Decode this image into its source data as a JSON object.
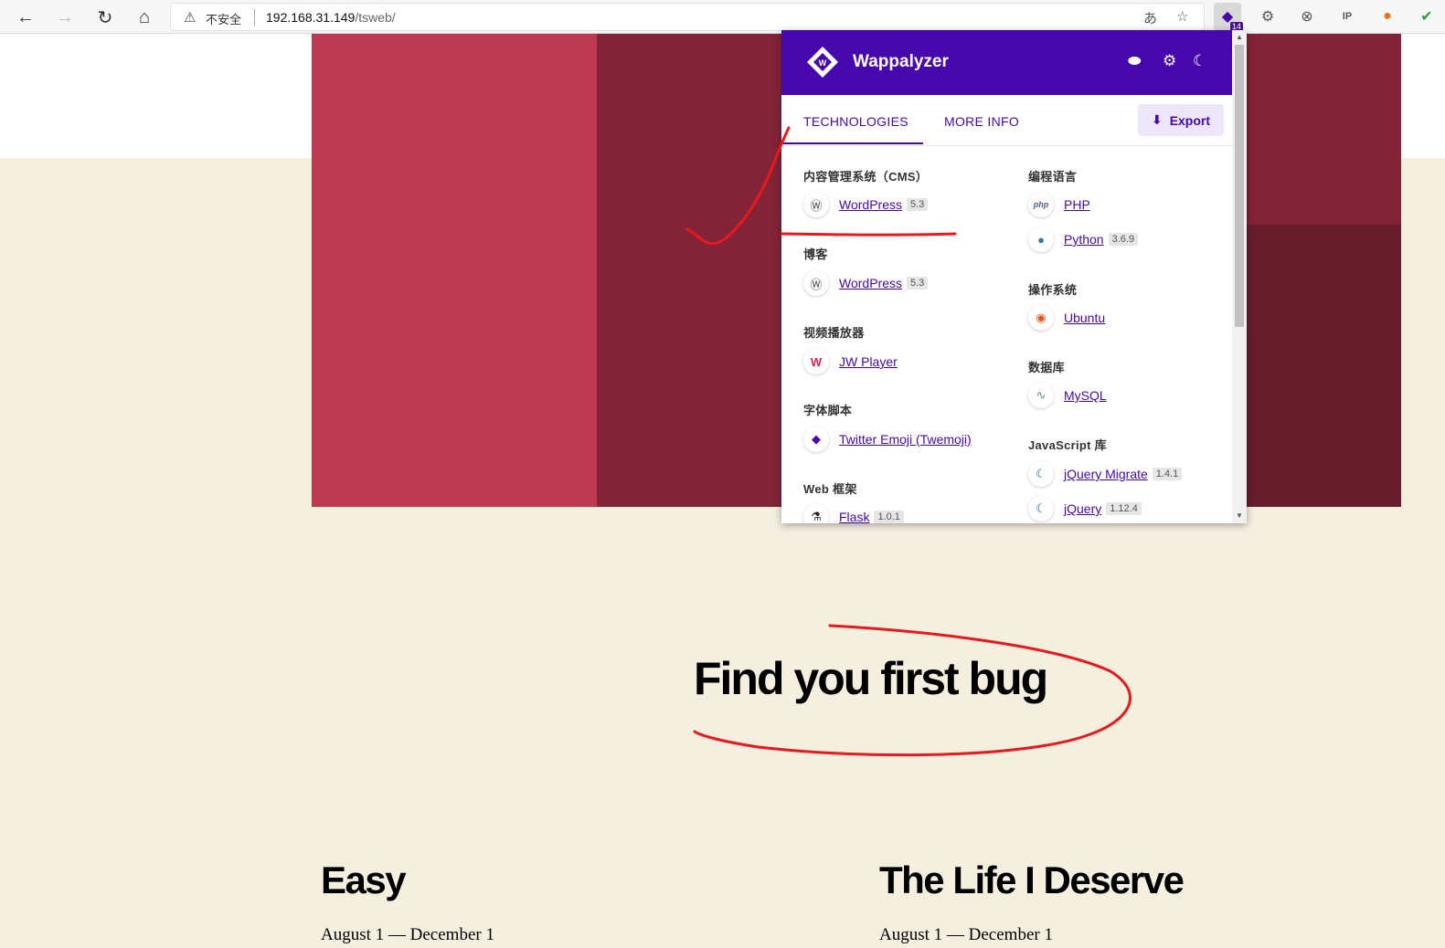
{
  "browser": {
    "insecure_label": "不安全",
    "url_host": "192.168.31.149",
    "url_path": "/tsweb/",
    "extension_badge": "14"
  },
  "page": {
    "heading": "Find you first bug",
    "cards": [
      {
        "title": "Easy",
        "date": "August 1 — December 1"
      },
      {
        "title": "The Life I Deserve",
        "date": "August 1 — December 1"
      }
    ],
    "colors": {
      "hero_left": "#bd3852",
      "hero_mid": "#822338",
      "hero_dark": "#681d2d",
      "background": "#f5efe0"
    }
  },
  "wappalyzer": {
    "brand": "Wappalyzer",
    "accent": "#4608ad",
    "tabs": [
      "TECHNOLOGIES",
      "MORE INFO"
    ],
    "export_label": "Export",
    "left_column": [
      {
        "category": "内容管理系统（CMS）",
        "items": [
          {
            "name": "WordPress",
            "version": "5.3",
            "icon": "wordpress-icon"
          }
        ]
      },
      {
        "category": "博客",
        "items": [
          {
            "name": "WordPress",
            "version": "5.3",
            "icon": "wordpress-icon"
          }
        ]
      },
      {
        "category": "视频播放器",
        "items": [
          {
            "name": "JW Player",
            "version": "",
            "icon": "jwplayer-icon"
          }
        ]
      },
      {
        "category": "字体脚本",
        "items": [
          {
            "name": "Twitter Emoji (Twemoji)",
            "version": "",
            "icon": "twemoji-icon"
          }
        ]
      },
      {
        "category": "Web 框架",
        "items": [
          {
            "name": "Flask",
            "version": "1.0.1",
            "icon": "flask-icon"
          }
        ]
      }
    ],
    "right_column": [
      {
        "category": "编程语言",
        "items": [
          {
            "name": "PHP",
            "version": "",
            "icon": "php-icon"
          },
          {
            "name": "Python",
            "version": "3.6.9",
            "icon": "python-icon"
          }
        ]
      },
      {
        "category": "操作系统",
        "items": [
          {
            "name": "Ubuntu",
            "version": "",
            "icon": "ubuntu-icon"
          }
        ]
      },
      {
        "category": "数据库",
        "items": [
          {
            "name": "MySQL",
            "version": "",
            "icon": "mysql-icon"
          }
        ]
      },
      {
        "category": "JavaScript 库",
        "items": [
          {
            "name": "jQuery Migrate",
            "version": "1.4.1",
            "icon": "jquery-icon"
          },
          {
            "name": "jQuery",
            "version": "1.12.4",
            "icon": "jquery-icon"
          }
        ]
      }
    ]
  }
}
